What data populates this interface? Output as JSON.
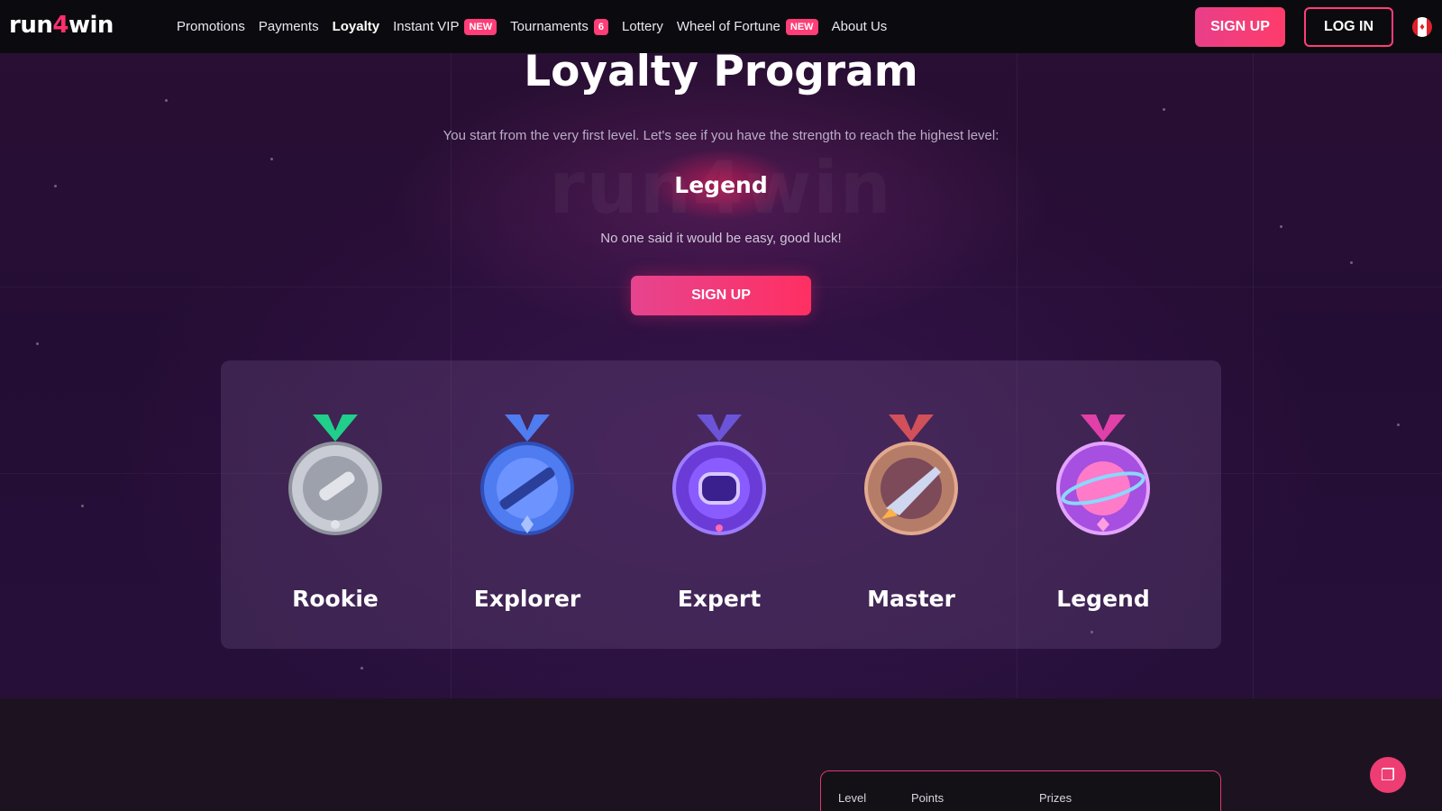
{
  "header": {
    "logo_text_a": "run",
    "logo_text_b": "4",
    "logo_text_c": "win",
    "nav": [
      {
        "label": "Promotions"
      },
      {
        "label": "Payments"
      },
      {
        "label": "Loyalty",
        "active": true
      },
      {
        "label": "Instant VIP",
        "badge": "NEW"
      },
      {
        "label": "Tournaments",
        "badge": "6"
      },
      {
        "label": "Lottery"
      },
      {
        "label": "Wheel of Fortune",
        "badge": "NEW"
      },
      {
        "label": "About Us"
      }
    ],
    "signup_label": "SIGN UP",
    "login_label": "LOG IN",
    "flag_icon": "canada-flag-icon"
  },
  "hero": {
    "title": "Loyalty Program",
    "subtitle": "You start from the very first level. Let's see if you have the strength to reach the highest level:",
    "watermark": "run4win",
    "highest_level": "Legend",
    "tagline": "No one said it would be easy, good luck!",
    "signup_label": "SIGN UP"
  },
  "levels": [
    {
      "name": "Rookie",
      "icon": "rookie-medal-icon",
      "color": "#c9ccd4",
      "ribbon": "#1fcf8a"
    },
    {
      "name": "Explorer",
      "icon": "explorer-medal-icon",
      "color": "#4f7cf0",
      "ribbon": "#4f7cf0"
    },
    {
      "name": "Expert",
      "icon": "expert-medal-icon",
      "color": "#7b45f0",
      "ribbon": "#6b54d8"
    },
    {
      "name": "Master",
      "icon": "master-medal-icon",
      "color": "#c58a6e",
      "ribbon": "#d1505a"
    },
    {
      "name": "Legend",
      "icon": "legend-medal-icon",
      "color": "#c04fe0",
      "ribbon": "#e040a8"
    }
  ],
  "table": {
    "headers": [
      "Level",
      "Points",
      "Prizes"
    ]
  },
  "colors": {
    "accent": "#ff3d78",
    "header_bg": "#0b0b0f",
    "page_bg": "#240d34"
  },
  "chat_icon": "chat-bubble-icon"
}
